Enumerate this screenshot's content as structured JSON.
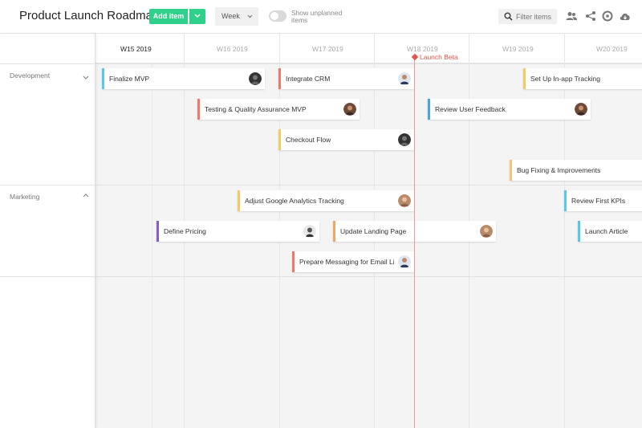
{
  "header": {
    "title": "Product Launch Roadmap",
    "add_label": "Add item",
    "view_select": "Week",
    "toggle_label": "Show unplanned items",
    "filter_placeholder": "Filter items"
  },
  "weeks": [
    "W15 2019",
    "W16 2019",
    "W17 2019",
    "W18 2019",
    "W19 2019",
    "W20 2019"
  ],
  "milestone": {
    "label": "Launch Beta",
    "color": "#e0564c"
  },
  "lanes": [
    {
      "name": "Development",
      "expanded": false
    },
    {
      "name": "Marketing",
      "expanded": true
    }
  ],
  "items": {
    "finalize_mvp": "Finalize MVP",
    "integrate_crm": "Integrate CRM",
    "setup_tracking": "Set Up In-app Tracking",
    "testing_qa": "Testing & Quality Assurance MVP",
    "review_feedback": "Review User Feedback",
    "checkout_flow": "Checkout Flow",
    "bug_fixing": "Bug Fixing & Improvements",
    "adjust_analytics": "Adjust Google Analytics Tracking",
    "review_kpis": "Review First KPIs",
    "define_pricing": "Define Pricing",
    "update_landing": "Update Landing Page",
    "launch_article": "Launch Article",
    "prepare_messaging": "Prepare Messaging for Email List"
  },
  "colors": {
    "accent_green": "#2fd18a",
    "milestone_red": "#e0564c"
  }
}
